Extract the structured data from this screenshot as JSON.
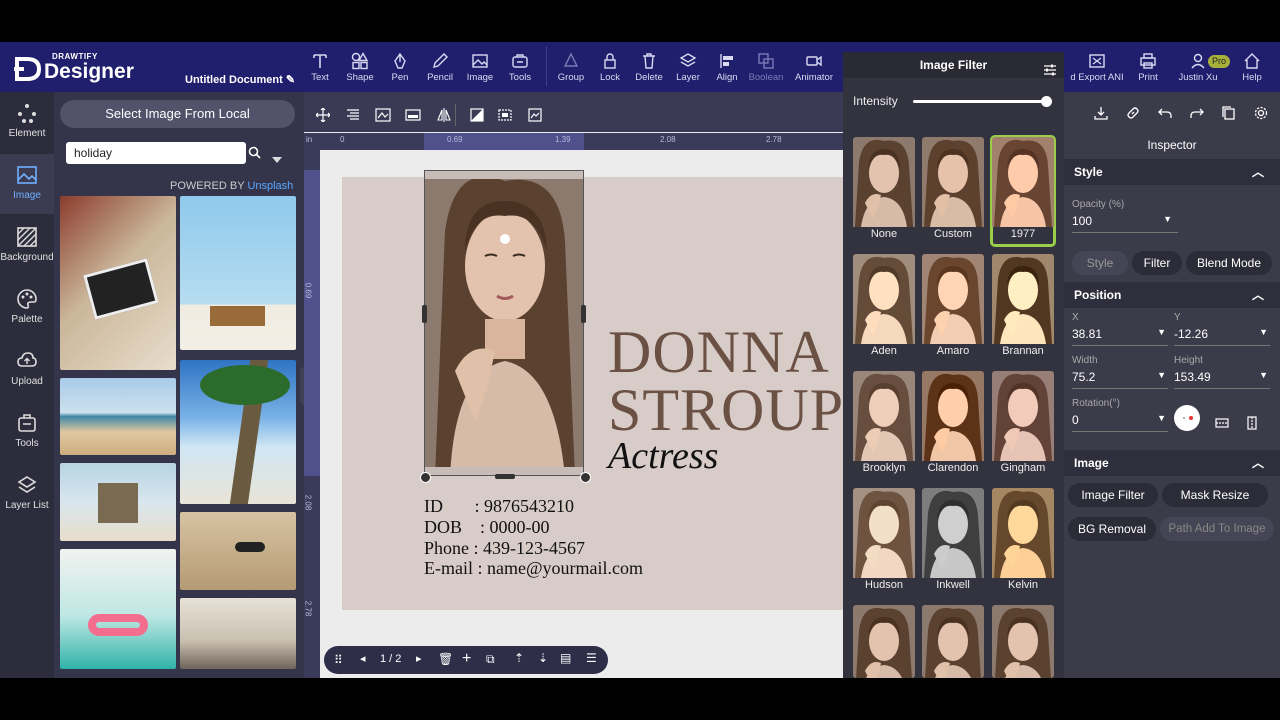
{
  "app": {
    "brand_small": "DRAWTIFY",
    "brand_name": "Designer",
    "document_title": "Untitled Document"
  },
  "toolbar": {
    "items": [
      "Text",
      "Shape",
      "Pen",
      "Pencil",
      "Image",
      "Tools",
      "Group",
      "Lock",
      "Delete",
      "Layer",
      "Align",
      "Boolean",
      "Animator"
    ],
    "right_items": [
      "d Export ANI",
      "Print",
      "Justin Xu",
      "Help"
    ],
    "pro_badge": "Pro"
  },
  "left_sidebar": [
    "Element",
    "Image",
    "Background",
    "Palette",
    "Upload",
    "Tools",
    "Layer List"
  ],
  "image_panel": {
    "select_button": "Select Image From Local",
    "search_value": "holiday",
    "powered_prefix": "POWERED BY",
    "powered_link": "Unsplash"
  },
  "ruler": {
    "unit": "in",
    "top_ticks": [
      "0",
      "0.69",
      "1.39",
      "2.08",
      "2.78"
    ],
    "left_ticks": [
      "0.69",
      "2.08",
      "2.78"
    ]
  },
  "card": {
    "first_name": "DONNA",
    "last_name": "STROUP",
    "role": "Actress",
    "id_line": "ID       : 9876543210",
    "dob_line": "DOB    : 0000-00",
    "phone_line": "Phone : 439-123-4567",
    "email_line": "E-mail : name@yourmail.com"
  },
  "pagination": {
    "current": "1 / 2"
  },
  "image_filter": {
    "title": "Image Filter",
    "intensity_label": "Intensity",
    "intensity_value": 1.0,
    "selected": "1977",
    "filters": [
      "None",
      "Custom",
      "1977",
      "Aden",
      "Amaro",
      "Brannan",
      "Brooklyn",
      "Clarendon",
      "Gingham",
      "Hudson",
      "Inkwell",
      "Kelvin",
      "",
      "",
      ""
    ]
  },
  "inspector": {
    "title": "Inspector",
    "style_section": "Style",
    "opacity_label": "Opacity (%)",
    "opacity_value": "100",
    "style_tabs": [
      "Style",
      "Filter",
      "Blend Mode"
    ],
    "position_section": "Position",
    "x_label": "X",
    "x_value": "38.81",
    "y_label": "Y",
    "y_value": "-12.26",
    "width_label": "Width",
    "width_value": "75.2",
    "height_label": "Height",
    "height_value": "153.49",
    "rotation_label": "Rotation(°)",
    "rotation_value": "0",
    "image_section": "Image",
    "image_buttons": [
      "Image Filter",
      "Mask Resize",
      "BG Removal",
      "Path Add To Image"
    ]
  },
  "colors": {
    "topbar": "#1f1f6e",
    "accent_selected": "#9acd4a",
    "link": "#5aa8ff",
    "name_text": "#6b5144"
  }
}
